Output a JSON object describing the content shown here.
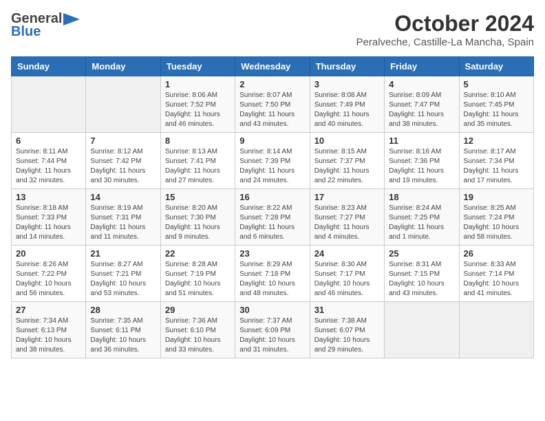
{
  "logo": {
    "general": "General",
    "blue": "Blue",
    "icon": "▶"
  },
  "title": {
    "month": "October 2024",
    "location": "Peralveche, Castille-La Mancha, Spain"
  },
  "weekdays": [
    "Sunday",
    "Monday",
    "Tuesday",
    "Wednesday",
    "Thursday",
    "Friday",
    "Saturday"
  ],
  "weeks": [
    [
      {
        "day": "",
        "detail": ""
      },
      {
        "day": "",
        "detail": ""
      },
      {
        "day": "1",
        "detail": "Sunrise: 8:06 AM\nSunset: 7:52 PM\nDaylight: 11 hours and 46 minutes."
      },
      {
        "day": "2",
        "detail": "Sunrise: 8:07 AM\nSunset: 7:50 PM\nDaylight: 11 hours and 43 minutes."
      },
      {
        "day": "3",
        "detail": "Sunrise: 8:08 AM\nSunset: 7:49 PM\nDaylight: 11 hours and 40 minutes."
      },
      {
        "day": "4",
        "detail": "Sunrise: 8:09 AM\nSunset: 7:47 PM\nDaylight: 11 hours and 38 minutes."
      },
      {
        "day": "5",
        "detail": "Sunrise: 8:10 AM\nSunset: 7:45 PM\nDaylight: 11 hours and 35 minutes."
      }
    ],
    [
      {
        "day": "6",
        "detail": "Sunrise: 8:11 AM\nSunset: 7:44 PM\nDaylight: 11 hours and 32 minutes."
      },
      {
        "day": "7",
        "detail": "Sunrise: 8:12 AM\nSunset: 7:42 PM\nDaylight: 11 hours and 30 minutes."
      },
      {
        "day": "8",
        "detail": "Sunrise: 8:13 AM\nSunset: 7:41 PM\nDaylight: 11 hours and 27 minutes."
      },
      {
        "day": "9",
        "detail": "Sunrise: 8:14 AM\nSunset: 7:39 PM\nDaylight: 11 hours and 24 minutes."
      },
      {
        "day": "10",
        "detail": "Sunrise: 8:15 AM\nSunset: 7:37 PM\nDaylight: 11 hours and 22 minutes."
      },
      {
        "day": "11",
        "detail": "Sunrise: 8:16 AM\nSunset: 7:36 PM\nDaylight: 11 hours and 19 minutes."
      },
      {
        "day": "12",
        "detail": "Sunrise: 8:17 AM\nSunset: 7:34 PM\nDaylight: 11 hours and 17 minutes."
      }
    ],
    [
      {
        "day": "13",
        "detail": "Sunrise: 8:18 AM\nSunset: 7:33 PM\nDaylight: 11 hours and 14 minutes."
      },
      {
        "day": "14",
        "detail": "Sunrise: 8:19 AM\nSunset: 7:31 PM\nDaylight: 11 hours and 11 minutes."
      },
      {
        "day": "15",
        "detail": "Sunrise: 8:20 AM\nSunset: 7:30 PM\nDaylight: 11 hours and 9 minutes."
      },
      {
        "day": "16",
        "detail": "Sunrise: 8:22 AM\nSunset: 7:28 PM\nDaylight: 11 hours and 6 minutes."
      },
      {
        "day": "17",
        "detail": "Sunrise: 8:23 AM\nSunset: 7:27 PM\nDaylight: 11 hours and 4 minutes."
      },
      {
        "day": "18",
        "detail": "Sunrise: 8:24 AM\nSunset: 7:25 PM\nDaylight: 11 hours and 1 minute."
      },
      {
        "day": "19",
        "detail": "Sunrise: 8:25 AM\nSunset: 7:24 PM\nDaylight: 10 hours and 58 minutes."
      }
    ],
    [
      {
        "day": "20",
        "detail": "Sunrise: 8:26 AM\nSunset: 7:22 PM\nDaylight: 10 hours and 56 minutes."
      },
      {
        "day": "21",
        "detail": "Sunrise: 8:27 AM\nSunset: 7:21 PM\nDaylight: 10 hours and 53 minutes."
      },
      {
        "day": "22",
        "detail": "Sunrise: 8:28 AM\nSunset: 7:19 PM\nDaylight: 10 hours and 51 minutes."
      },
      {
        "day": "23",
        "detail": "Sunrise: 8:29 AM\nSunset: 7:18 PM\nDaylight: 10 hours and 48 minutes."
      },
      {
        "day": "24",
        "detail": "Sunrise: 8:30 AM\nSunset: 7:17 PM\nDaylight: 10 hours and 46 minutes."
      },
      {
        "day": "25",
        "detail": "Sunrise: 8:31 AM\nSunset: 7:15 PM\nDaylight: 10 hours and 43 minutes."
      },
      {
        "day": "26",
        "detail": "Sunrise: 8:33 AM\nSunset: 7:14 PM\nDaylight: 10 hours and 41 minutes."
      }
    ],
    [
      {
        "day": "27",
        "detail": "Sunrise: 7:34 AM\nSunset: 6:13 PM\nDaylight: 10 hours and 38 minutes."
      },
      {
        "day": "28",
        "detail": "Sunrise: 7:35 AM\nSunset: 6:11 PM\nDaylight: 10 hours and 36 minutes."
      },
      {
        "day": "29",
        "detail": "Sunrise: 7:36 AM\nSunset: 6:10 PM\nDaylight: 10 hours and 33 minutes."
      },
      {
        "day": "30",
        "detail": "Sunrise: 7:37 AM\nSunset: 6:09 PM\nDaylight: 10 hours and 31 minutes."
      },
      {
        "day": "31",
        "detail": "Sunrise: 7:38 AM\nSunset: 6:07 PM\nDaylight: 10 hours and 29 minutes."
      },
      {
        "day": "",
        "detail": ""
      },
      {
        "day": "",
        "detail": ""
      }
    ]
  ]
}
